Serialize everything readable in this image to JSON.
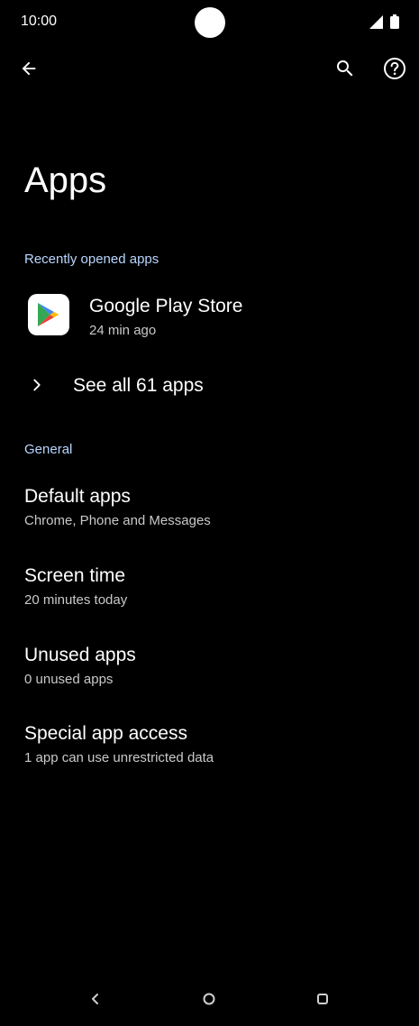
{
  "status_bar": {
    "time": "10:00"
  },
  "header": {
    "title": "Apps",
    "icons": [
      "back-arrow-icon",
      "search-icon",
      "help-icon"
    ]
  },
  "recent": {
    "section_label": "Recently opened apps",
    "apps": [
      {
        "name": "Google Play Store",
        "time": "24 min ago",
        "icon": "google-play-icon"
      }
    ],
    "see_all_label": "See all 61 apps"
  },
  "general": {
    "section_label": "General",
    "items": [
      {
        "title": "Default apps",
        "subtitle": "Chrome, Phone and Messages"
      },
      {
        "title": "Screen time",
        "subtitle": "20 minutes today"
      },
      {
        "title": "Unused apps",
        "subtitle": "0 unused apps"
      },
      {
        "title": "Special app access",
        "subtitle": "1 app can use unrestricted data"
      }
    ]
  },
  "nav_bar": {
    "icons": [
      "nav-back-icon",
      "nav-home-icon",
      "nav-recents-icon"
    ]
  },
  "colors": {
    "background": "#000000",
    "section_header": "#b8d6ff",
    "primary_text": "#ffffff",
    "secondary_text": "#c9c9c9"
  }
}
